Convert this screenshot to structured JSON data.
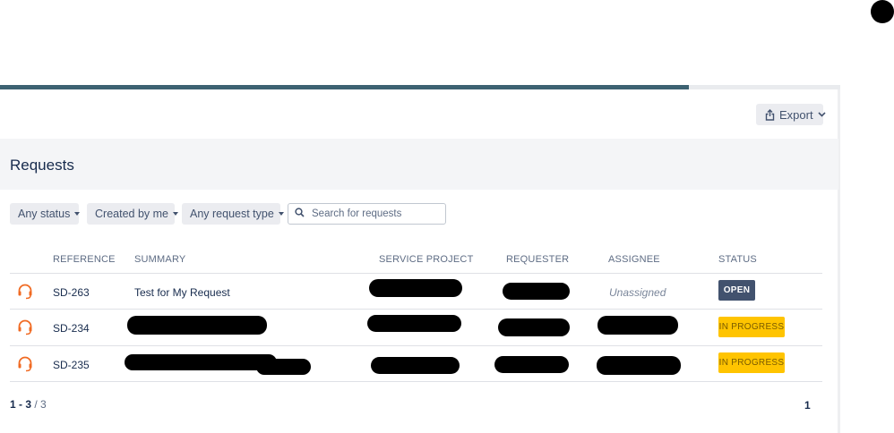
{
  "progress": {
    "fraction": 0.82
  },
  "toolbar": {
    "export_label": "Export",
    "export_icon": "share-icon",
    "chevron_icon": "chevron-down-icon"
  },
  "page": {
    "title": "Requests"
  },
  "filters": {
    "status": "Any status",
    "created_by": "Created by me",
    "request_type": "Any request type"
  },
  "search": {
    "placeholder": "Search for requests",
    "value": "",
    "icon": "search-icon"
  },
  "table": {
    "columns": [
      "REFERENCE",
      "SUMMARY",
      "SERVICE PROJECT",
      "REQUESTER",
      "ASSIGNEE",
      "STATUS"
    ],
    "row_icon": "headset-icon",
    "rows": [
      {
        "reference": "SD-263",
        "summary": "Test for My Request",
        "assignee": "Unassigned",
        "status": "OPEN"
      },
      {
        "reference": "SD-234",
        "summary": "",
        "assignee": "",
        "status": "IN PROGRESS"
      },
      {
        "reference": "SD-235",
        "summary": "",
        "assignee": "",
        "status": "IN PROGRESS"
      }
    ]
  },
  "pagination": {
    "range": "1 - 3",
    "separator": " / ",
    "total": "3",
    "current_page": "1"
  },
  "colors": {
    "accent": "#3d6272",
    "open_status": "#42526e",
    "in_progress_status": "#ffc400",
    "row_icon": "#f06a22"
  }
}
